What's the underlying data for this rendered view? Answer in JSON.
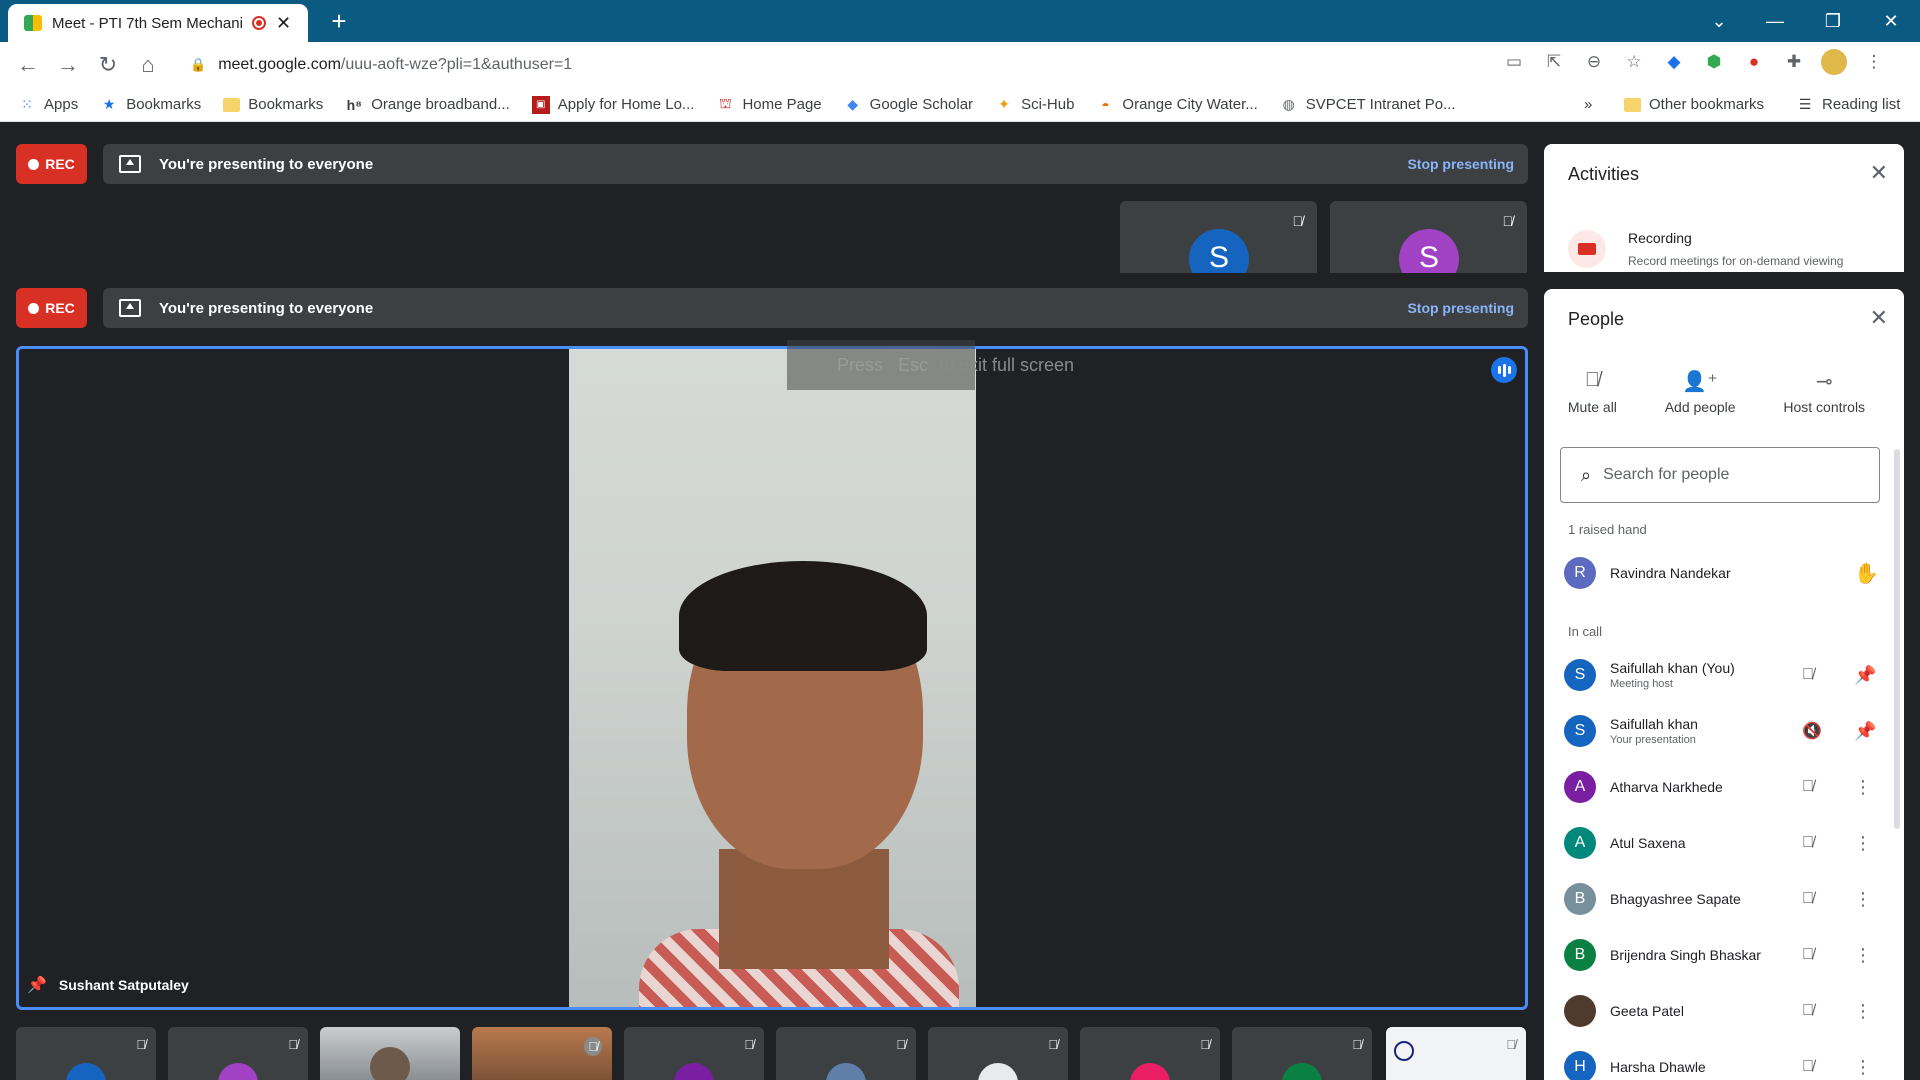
{
  "browser": {
    "tab_title": "Meet - PTI 7th Sem Mechani",
    "url_host": "meet.google.com",
    "url_path": "/uuu-aoft-wze?pli=1&authuser=1",
    "bookmarks": [
      {
        "label": "Apps",
        "icon": "apps-grid-icon"
      },
      {
        "label": "Bookmarks",
        "icon": "star-icon"
      },
      {
        "label": "Bookmarks",
        "icon": "folder-icon"
      },
      {
        "label": "Orange broadband...",
        "icon": "h8-icon"
      },
      {
        "label": "Apply for Home Lo...",
        "icon": "bank-icon"
      },
      {
        "label": "Home Page",
        "icon": "home-page-icon"
      },
      {
        "label": "Google Scholar",
        "icon": "scholar-icon"
      },
      {
        "label": "Sci-Hub",
        "icon": "scihub-icon"
      },
      {
        "label": "Orange City Water...",
        "icon": "water-icon"
      },
      {
        "label": "SVPCET Intranet Po...",
        "icon": "globe-icon"
      }
    ],
    "other_bookmarks": "Other bookmarks",
    "reading_list": "Reading list",
    "overflow": "»"
  },
  "meet": {
    "rec_label": "REC",
    "presenting_text": "You're presenting to everyone",
    "stop_presenting": "Stop presenting",
    "top_tiles": [
      {
        "initial": "S",
        "color": "#1565c0"
      },
      {
        "initial": "S",
        "color": "#a142c4"
      }
    ],
    "fullscreen_hint": {
      "press": "Press",
      "key": "Esc",
      "tail": "to exit full screen"
    },
    "speaker_name": "Sushant Satputaley"
  },
  "activities": {
    "title": "Activities",
    "recording_title": "Recording",
    "recording_desc": "Record meetings for on-demand viewing"
  },
  "people": {
    "title": "People",
    "mute_all": "Mute all",
    "add_people": "Add people",
    "host_controls": "Host controls",
    "search_placeholder": "Search for people",
    "raised_hand_label": "1 raised hand",
    "raised": {
      "name": "Ravindra Nandekar",
      "initial": "R",
      "color": "#5c6bc0"
    },
    "in_call_label": "In call",
    "participants": [
      {
        "name": "Saifullah khan (You)",
        "sub": "Meeting host",
        "initial": "S",
        "color": "#1565c0",
        "action": "pin"
      },
      {
        "name": "Saifullah khan",
        "sub": "Your presentation",
        "initial": "S",
        "color": "#1565c0",
        "action": "pin"
      },
      {
        "name": "Atharva Narkhede",
        "sub": "",
        "initial": "A",
        "color": "#7b1fa2",
        "action": "more"
      },
      {
        "name": "Atul Saxena",
        "sub": "",
        "initial": "A",
        "color": "#00897b",
        "action": "more"
      },
      {
        "name": "Bhagyashree Sapate",
        "sub": "",
        "initial": "B",
        "color": "#78909c",
        "action": "more"
      },
      {
        "name": "Brijendra Singh Bhaskar",
        "sub": "",
        "initial": "B",
        "color": "#0b8043",
        "action": "more"
      },
      {
        "name": "Geeta Patel",
        "sub": "",
        "initial": "",
        "color": "#4e3b2e",
        "action": "more"
      },
      {
        "name": "Harsha Dhawle",
        "sub": "",
        "initial": "H",
        "color": "#1565c0",
        "action": "more"
      }
    ]
  }
}
